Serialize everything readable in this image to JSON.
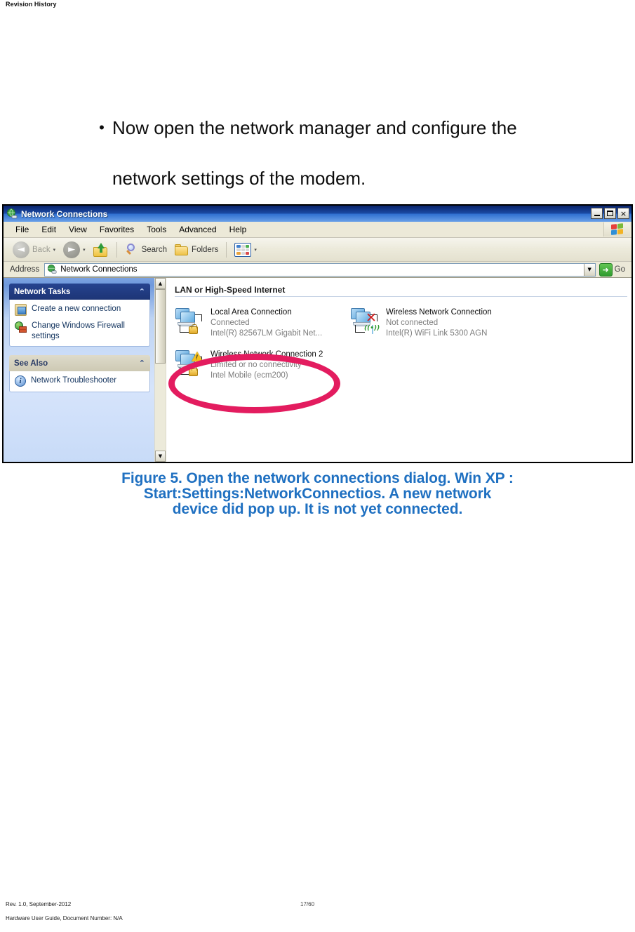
{
  "page": {
    "header": "Revision History"
  },
  "bullet": {
    "marker": "•",
    "line1": "Now open the network manager and configure the",
    "line2": "network settings of the modem."
  },
  "window": {
    "title": "Network Connections",
    "title_icon": "network-globe-icon",
    "controls": {
      "minimize": "minimize-button",
      "maximize": "maximize-button",
      "close": "×"
    },
    "menu": [
      "File",
      "Edit",
      "View",
      "Favorites",
      "Tools",
      "Advanced",
      "Help"
    ],
    "brand_icon": "windows-flag-icon",
    "toolbar": {
      "back": "Back",
      "forward": "",
      "up": "",
      "search": "Search",
      "folders": "Folders",
      "views": "",
      "back_caret": "▾",
      "forward_caret": "▾",
      "views_caret": "▾",
      "back_glyph": "◄",
      "forward_glyph": "►"
    },
    "address": {
      "label": "Address",
      "value": "Network Connections",
      "dropdown_glyph": "▼",
      "go_label": "Go",
      "go_glyph": "➜"
    },
    "sidebar": {
      "panels": [
        {
          "title": "Network Tasks",
          "collapse_glyph": "⌃",
          "items": [
            {
              "icon": "new-connection-icon",
              "label": "Create a new connection"
            },
            {
              "icon": "windows-firewall-icon",
              "label": "Change Windows Firewall settings"
            }
          ]
        },
        {
          "title": "See Also",
          "collapse_glyph": "⌃",
          "items": [
            {
              "icon": "info-icon",
              "label": "Network Troubleshooter"
            }
          ]
        }
      ]
    },
    "scrollbar": {
      "up_glyph": "▲",
      "down_glyph": "▼"
    },
    "content": {
      "group_title": "LAN or High-Speed Internet",
      "connections": [
        {
          "name": "Local Area Connection",
          "status": "Connected",
          "device": "Intel(R) 82567LM Gigabit Net...",
          "badge": "lock"
        },
        {
          "name": "Wireless Network Connection",
          "status": "Not connected",
          "device": "Intel(R) WiFi Link 5300 AGN",
          "badge": "x-wifi"
        },
        {
          "name": "Wireless Network Connection 2",
          "status": "Limited or no connectivity",
          "device": "Intel Mobile (ecm200)",
          "badge": "warning",
          "highlighted": true
        }
      ]
    }
  },
  "caption": {
    "line1": "Figure 5. Open the network connections dialog. Win XP :",
    "line2": "Start:Settings:NetworkConnectios.  A new network",
    "line3": "device did pop up. It is not yet connected.",
    "color": "#1f70c1"
  },
  "footer": {
    "revision": "Rev. 1.0, September-2012",
    "page": "17/60",
    "document": "Hardware User Guide, Document Number: N/A"
  }
}
